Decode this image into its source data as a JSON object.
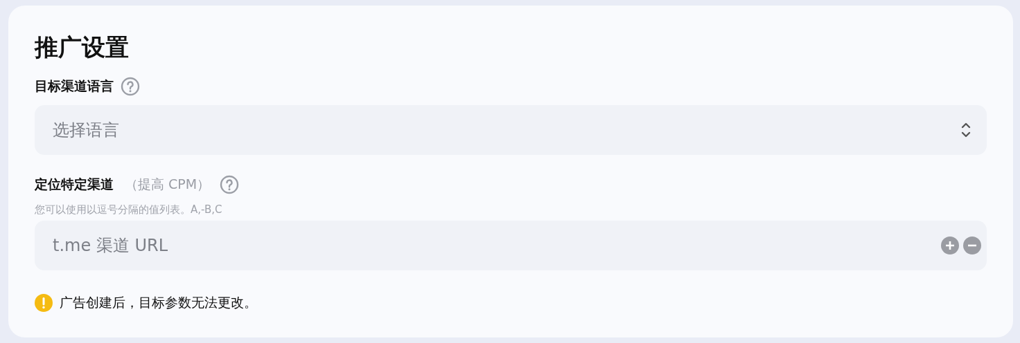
{
  "title": "推广设置",
  "language_field": {
    "label": "目标渠道语言",
    "placeholder": "选择语言"
  },
  "channel_field": {
    "label": "定位特定渠道",
    "label_note": "（提高 CPM）",
    "hint": "您可以使用以逗号分隔的值列表。A,-B,C",
    "placeholder": "t.me 渠道 URL"
  },
  "warning": "广告创建后，目标参数无法更改。"
}
